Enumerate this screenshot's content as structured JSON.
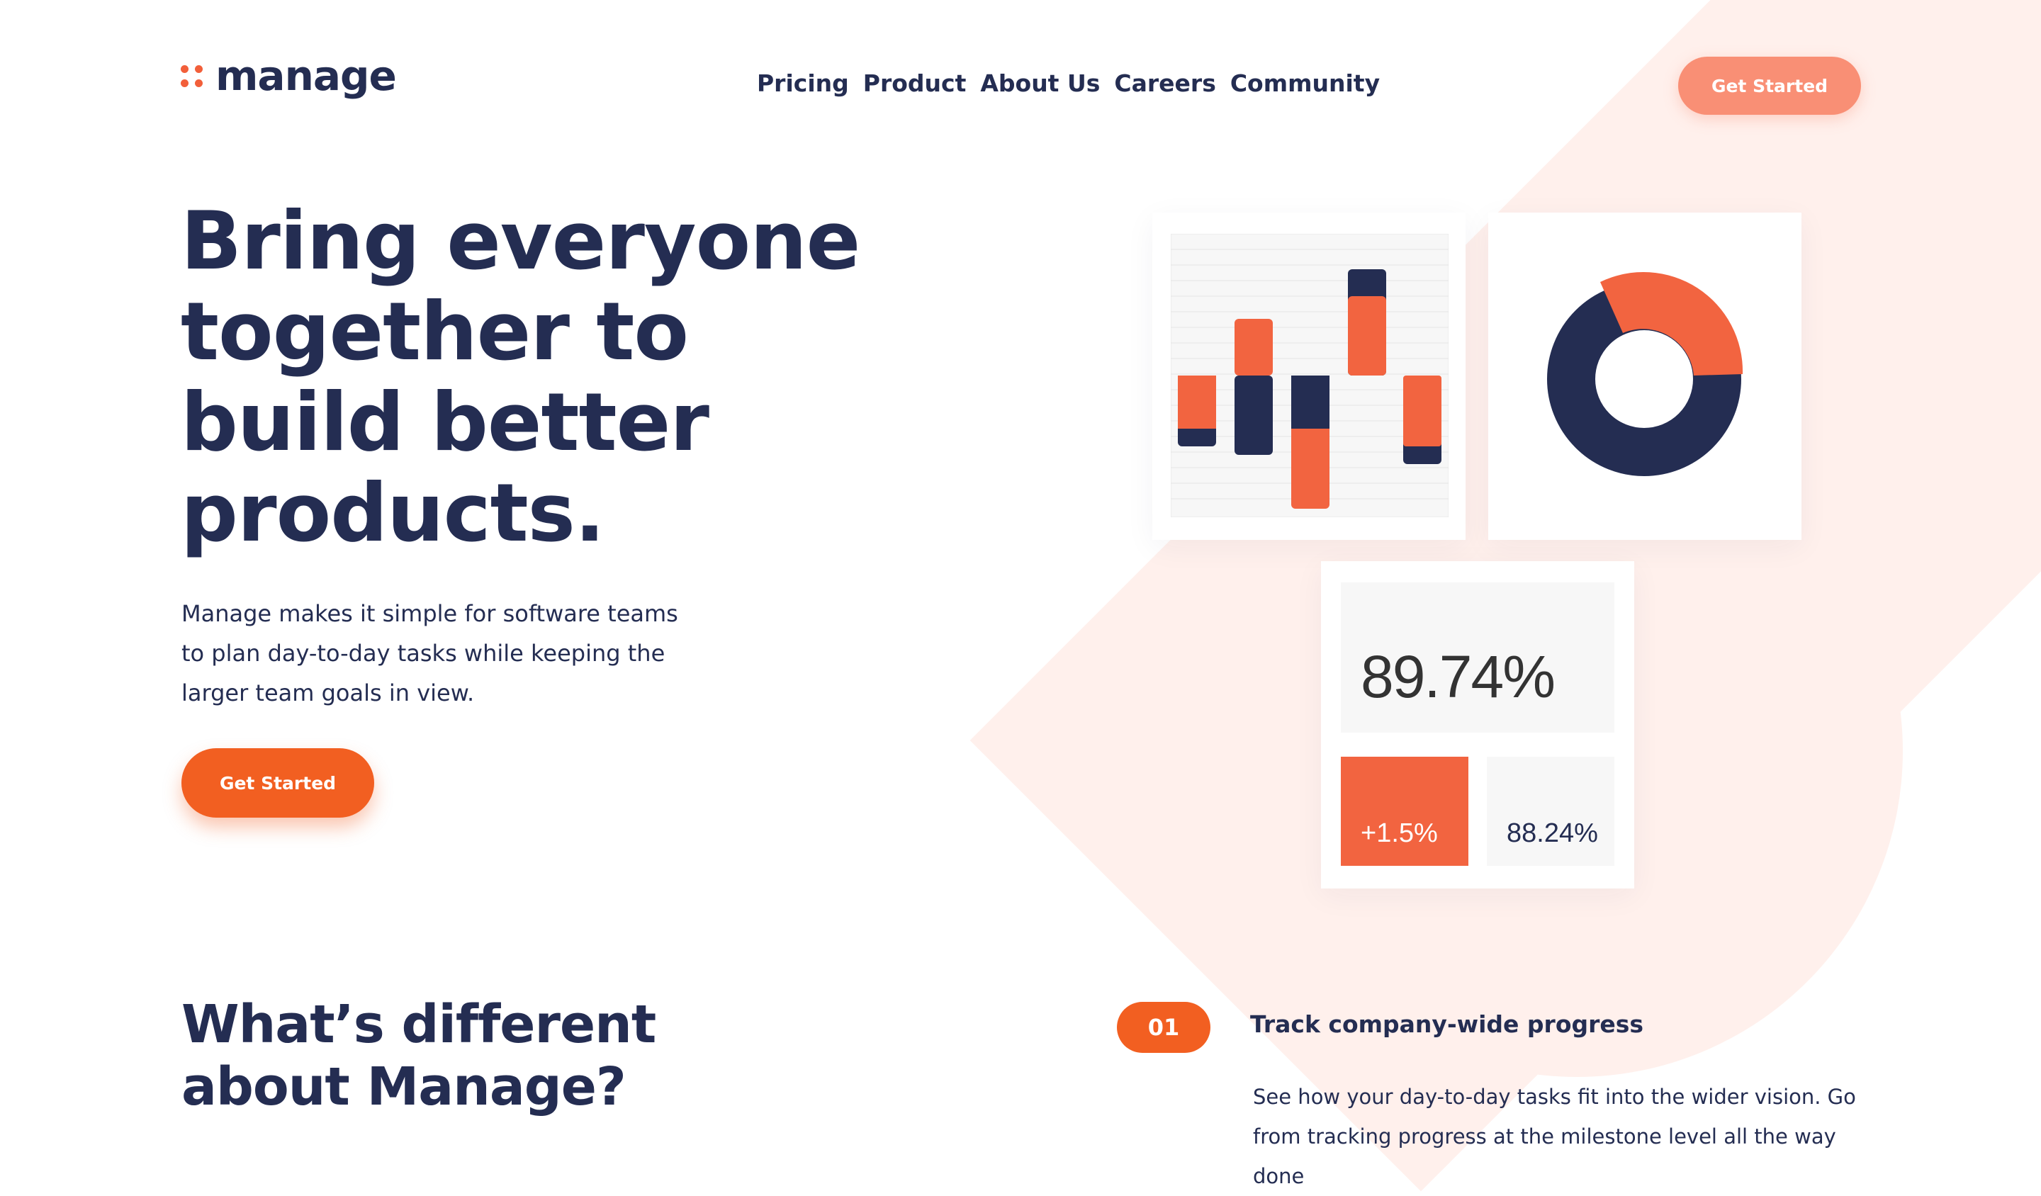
{
  "brand": {
    "name": "manage",
    "accent": "#f25f3a",
    "dark": "#242d52"
  },
  "nav": {
    "items": [
      "Pricing",
      "Product",
      "About Us",
      "Careers",
      "Community"
    ]
  },
  "header": {
    "cta_label": "Get Started"
  },
  "hero": {
    "title": "Bring everyone together to build better products.",
    "text": "Manage makes it simple for software teams to plan day-to-day tasks while keeping the larger team goals in view.",
    "cta_label": "Get Started"
  },
  "illustration": {
    "stat_main": "89.74%",
    "stat_change": "+1.5%",
    "stat_secondary": "88.24%"
  },
  "section": {
    "title": "What’s different about Manage?"
  },
  "features": [
    {
      "number": "01",
      "title": "Track company-wide progress",
      "text": "See how your day-to-day tasks fit into the wider vision. Go from tracking progress at the milestone level all the way done"
    }
  ]
}
